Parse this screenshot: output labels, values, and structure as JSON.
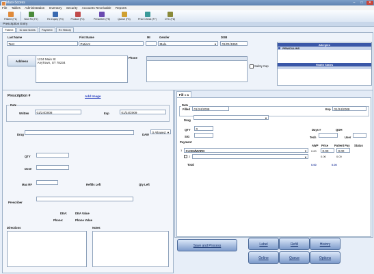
{
  "window": {
    "title": "Maxi-Scores"
  },
  "menu": [
    "File",
    "Tables",
    "Administration",
    "Inventory",
    "Security",
    "Accounts Receivable",
    "Reports"
  ],
  "toolbar": [
    {
      "label": "Patient (F1)",
      "color": "#e08a3a"
    },
    {
      "label": "New Rx (F2)",
      "color": "#4a8a3a"
    },
    {
      "label": "Rx Inquiry (F3)",
      "color": "#3a6ab0"
    },
    {
      "label": "Product (F4)",
      "color": "#c04a4a"
    },
    {
      "label": "Prescriber (F5)",
      "color": "#6a4ab0"
    },
    {
      "label": "Queue (F6)",
      "color": "#d0a030"
    },
    {
      "label": "Price Check (F7)",
      "color": "#3a9a9a"
    },
    {
      "label": "OTC (F8)",
      "color": "#8a8a3a"
    }
  ],
  "subtitle": "Prescription Entry",
  "tabs": [
    "Patient",
    "ID and Notes",
    "Payment",
    "Rx History"
  ],
  "patient": {
    "last_name_label": "Last Name",
    "last_name": "Test",
    "first_name_label": "First Name",
    "first_name": "Patient",
    "mi_label": "MI",
    "mi": "",
    "gender_label": "Gender",
    "gender": "Male",
    "dob_label": "DOB",
    "dob": "01/01/1950",
    "address_button": "Address",
    "address_line1": "1234 Main St",
    "address_line2": "AnyTown, ST 78234",
    "phone_label": "Phone",
    "safety_cap_label": "Safety Cap",
    "allergies_header": "Allergies",
    "allergy_1": "PENICILLINS",
    "health_header": "Health States"
  },
  "rx": {
    "title": "Prescription #",
    "add_image": "Add Image",
    "date_group": "Date",
    "written_label": "Written",
    "written": "01/24/2008",
    "exp_label": "Exp",
    "exp": "01/24/2009",
    "drug_label": "Drug",
    "daw_label": "DAW",
    "daw": "0 Allowed",
    "qty_label": "QTY",
    "dose_label": "Dose",
    "max_rf_label": "Max RF",
    "refills_left_label": "Refills Left",
    "qty_left_label": "Qty Left",
    "prescriber_label": "Prescriber",
    "dea_label": "DEA:",
    "dea_value_label": "DEA Value",
    "phone_label": "Phone:",
    "phone_value_label": "Phone Value",
    "directions_label": "Directions",
    "notes_label": "Notes"
  },
  "fill": {
    "tab": "Fill = 1",
    "date_group": "Date",
    "filled_label": "Filled",
    "filled": "01/24/2008",
    "exp_label": "Exp",
    "exp": "01/24/2008",
    "drug_label": "Drug",
    "qty_label": "QTY",
    "qty": "0",
    "sig_label": "SIG",
    "sig": "",
    "days_label": "Days #",
    "qoh_label": "QOH",
    "tech_label": "Tech",
    "user_label": "User",
    "user": "",
    "payment_label": "Payment",
    "awp_label": "AWP",
    "price_label": "Price",
    "patient_pay_label": "Patient Pay",
    "status_label": "Status",
    "row1_num": "1",
    "row1_name": "CASH/MARK",
    "row1_awp": "0.00",
    "row1_price": "0.00",
    "row1_pay": "0.00",
    "row2_num": "2",
    "row2_price": "0.00",
    "row2_pay": "0.00",
    "total_label": "Total",
    "total_price": "0.00",
    "total_pay": "0.00"
  },
  "actions": {
    "save": "Save and Process",
    "label": "Label",
    "refill": "Refill",
    "history": "History",
    "online": "Online",
    "queue": "Queue",
    "options": "Options"
  }
}
